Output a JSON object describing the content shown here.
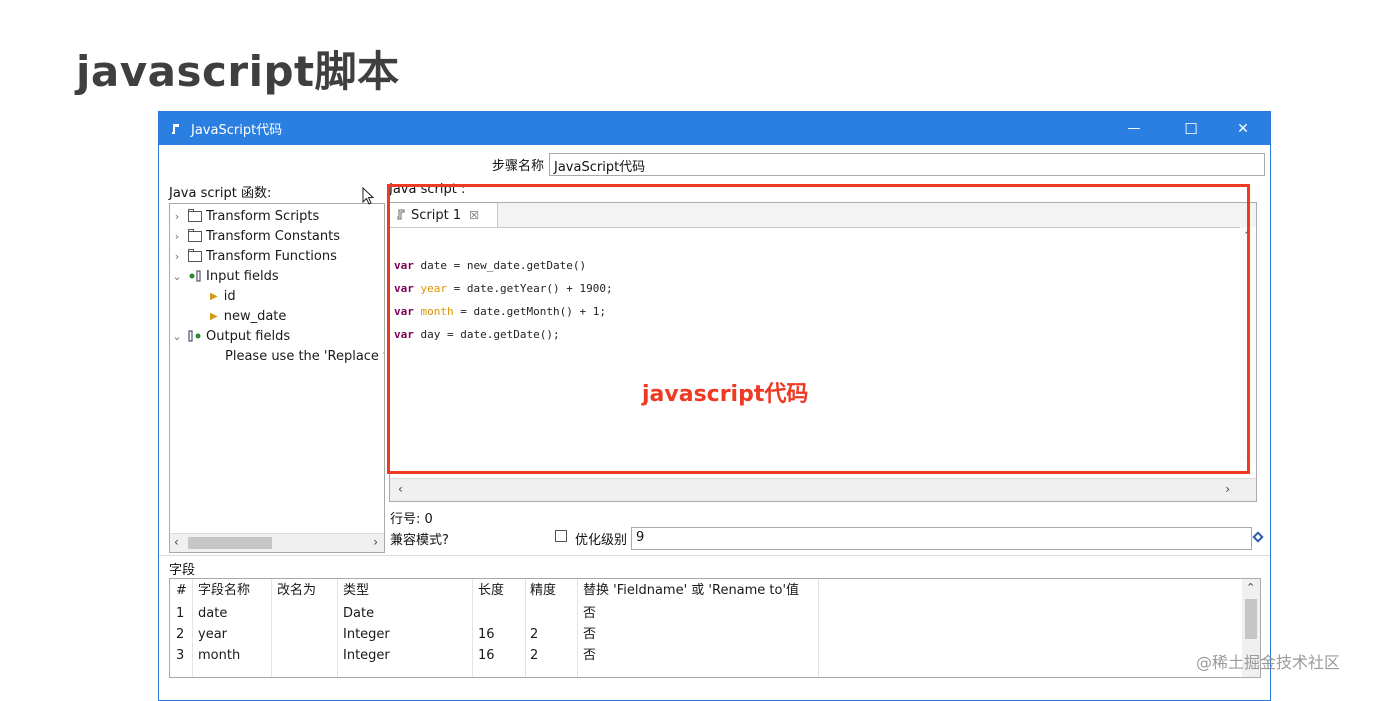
{
  "slide": {
    "title": "javascript脚本"
  },
  "window": {
    "title": "JavaScript代码",
    "minimize": "—",
    "maximize": "☐",
    "close": "✕"
  },
  "step_name": {
    "label": "步骤名称",
    "value": "JavaScript代码"
  },
  "functions": {
    "label": "Java script 函数:",
    "tree": [
      {
        "label": "Transform Scripts",
        "type": "folder",
        "expanded": false
      },
      {
        "label": "Transform Constants",
        "type": "folder",
        "expanded": false
      },
      {
        "label": "Transform Functions",
        "type": "folder",
        "expanded": false
      },
      {
        "label": "Input fields",
        "type": "input",
        "expanded": true
      },
      {
        "label": "id",
        "type": "field"
      },
      {
        "label": "new_date",
        "type": "field"
      },
      {
        "label": "Output fields",
        "type": "output",
        "expanded": true
      },
      {
        "label": "Please use the 'Replace v",
        "type": "note"
      }
    ]
  },
  "script": {
    "label": "Java script :",
    "tab": {
      "label": "Script 1",
      "close": "☒"
    },
    "lines": [
      {
        "kw": "var",
        "name": "date",
        "rest": " = new_date.getDate()",
        "highlight": false
      },
      {
        "kw": "var",
        "name": "year",
        "rest": " = date.getYear() + 1900;",
        "highlight": true
      },
      {
        "kw": "var",
        "name": "month",
        "rest": " = date.getMonth() + 1;",
        "highlight": true
      },
      {
        "kw": "var",
        "name": "day",
        "rest": " = date.getDate();",
        "highlight": false
      }
    ],
    "annotation": "javascript代码",
    "annotation_color": "#ee3a23"
  },
  "line_number": "行号: 0",
  "compat_mode": {
    "label": "兼容模式?"
  },
  "optimize": {
    "label": "优化级别",
    "value": "9"
  },
  "fields": {
    "label": "字段",
    "columns": [
      "#",
      "字段名称",
      "改名为",
      "类型",
      "长度",
      "精度",
      "替换 'Fieldname' 或 'Rename to'值"
    ],
    "rows": [
      [
        "1",
        "date",
        "",
        "Date",
        "",
        "",
        "否"
      ],
      [
        "2",
        "year",
        "",
        "Integer",
        "16",
        "2",
        "否"
      ],
      [
        "3",
        "month",
        "",
        "Integer",
        "16",
        "2",
        "否"
      ]
    ]
  },
  "watermark": "@稀土掘金技术社区",
  "colors": {
    "titlebar": "#2b7fe0",
    "keyword": "#7f0055",
    "variable": "#e09400"
  }
}
